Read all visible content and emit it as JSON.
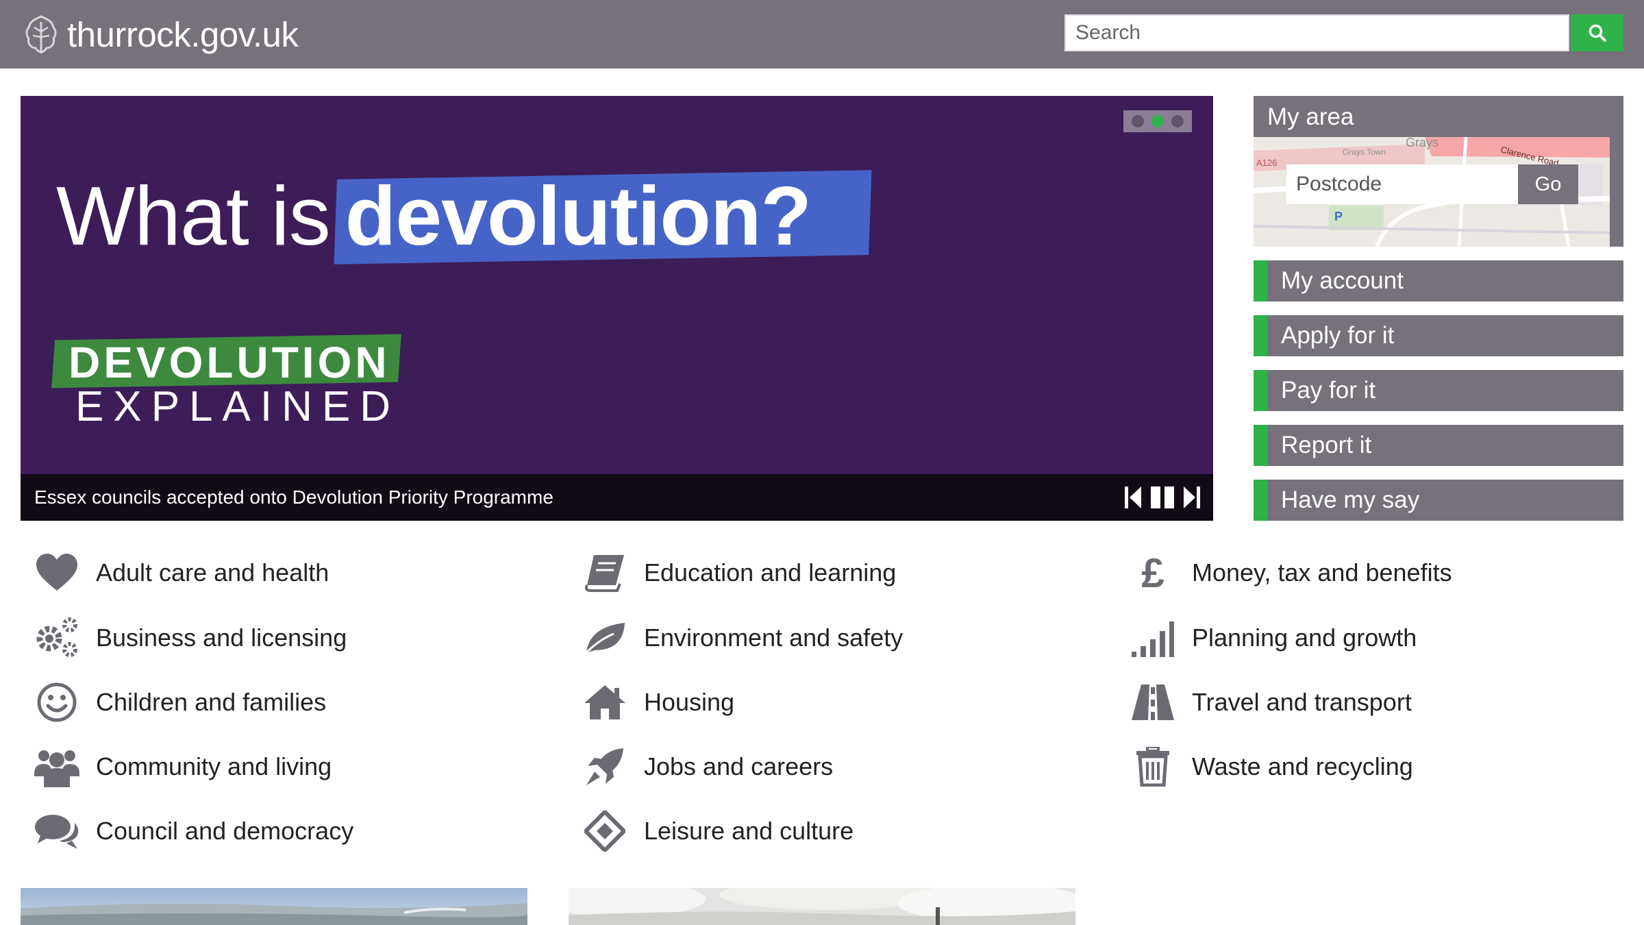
{
  "header": {
    "site_name": "thurrock.gov.uk",
    "search_placeholder": "Search"
  },
  "hero": {
    "headline_pre": "What is",
    "headline_highlight": "devolution?",
    "badge": "DEVOLUTION",
    "badge_sub": "EXPLAINED",
    "caption": "Essex councils accepted onto Devolution Priority Programme",
    "slide_count": 3,
    "active_slide": 2
  },
  "myarea": {
    "title": "My area",
    "postcode_placeholder": "Postcode",
    "go_label": "Go",
    "map_labels": {
      "grays": "Grays",
      "grays_town": "Grays Town",
      "a126": "A126",
      "clarence": "Clarence Road",
      "parking": "P"
    }
  },
  "quick_links": [
    {
      "label": "My account"
    },
    {
      "label": "Apply for it"
    },
    {
      "label": "Pay for it"
    },
    {
      "label": "Report it"
    },
    {
      "label": "Have my say"
    }
  ],
  "services": {
    "col1": [
      {
        "label": "Adult care and health",
        "icon": "heart-icon"
      },
      {
        "label": "Business and licensing",
        "icon": "gears-icon"
      },
      {
        "label": "Children and families",
        "icon": "smiley-icon"
      },
      {
        "label": "Community and living",
        "icon": "people-icon"
      },
      {
        "label": "Council and democracy",
        "icon": "speech-bubbles-icon"
      }
    ],
    "col2": [
      {
        "label": "Education and learning",
        "icon": "book-icon"
      },
      {
        "label": "Environment and safety",
        "icon": "leaf-icon"
      },
      {
        "label": "Housing",
        "icon": "house-icon"
      },
      {
        "label": "Jobs and careers",
        "icon": "rocket-icon"
      },
      {
        "label": "Leisure and culture",
        "icon": "ticket-icon"
      }
    ],
    "col3": [
      {
        "label": "Money, tax and benefits",
        "icon": "pound-icon"
      },
      {
        "label": "Planning and growth",
        "icon": "bar-chart-icon"
      },
      {
        "label": "Travel and transport",
        "icon": "road-icon"
      },
      {
        "label": "Waste and recycling",
        "icon": "bin-icon"
      }
    ]
  },
  "colors": {
    "header_bg": "#76717a",
    "accent_green": "#2fb24a",
    "hero_purple": "#3c1d57",
    "highlight_blue": "#4664c8",
    "badge_green": "#3d8a3f",
    "icon_grey": "#6e6a73"
  }
}
